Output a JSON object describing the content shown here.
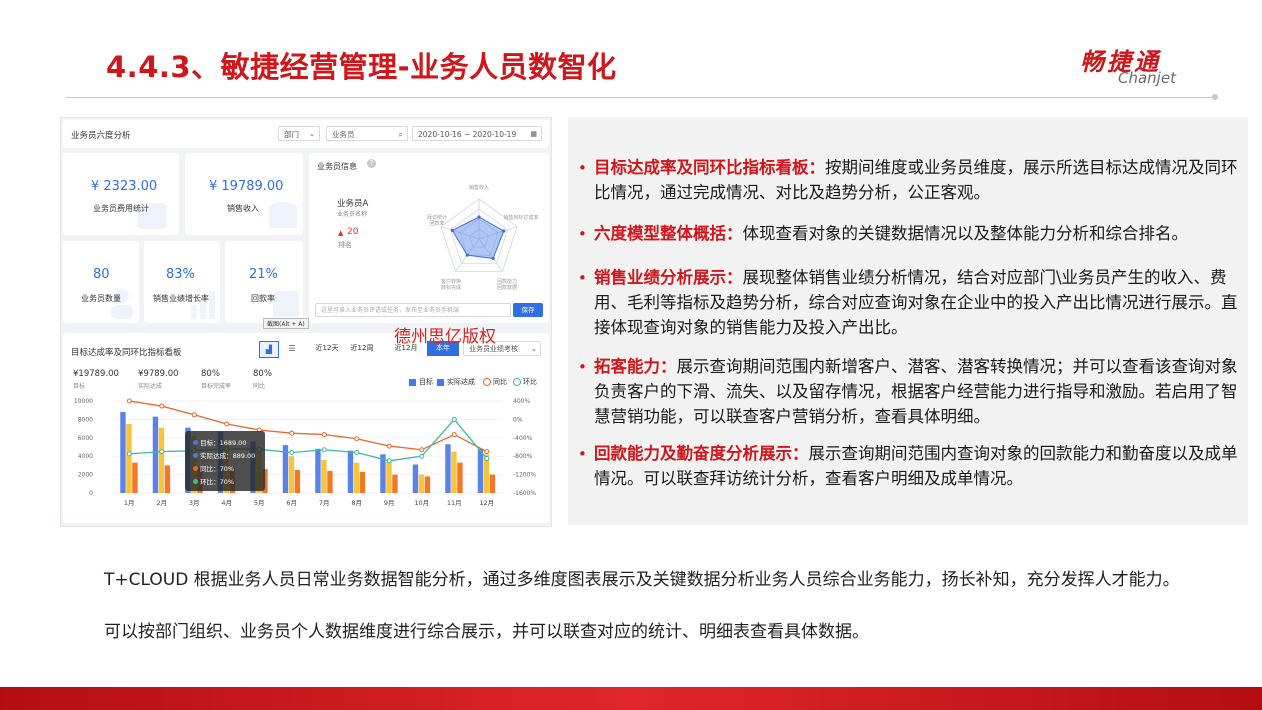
{
  "slide": {
    "title": "4.4.3、敏捷经营管理-业务人员数智化",
    "logo_cn": "畅捷通",
    "logo_en": "Chanjet"
  },
  "dashboard": {
    "header": {
      "title": "业务员六度分析",
      "dept_select": "部门",
      "salesperson_placeholder": "业务员",
      "date_range": "2020-10-16 ~ 2020-10-19"
    },
    "kpis": [
      {
        "value": "¥ 2323.00",
        "label": "业务员费用统计"
      },
      {
        "value": "¥ 19789.00",
        "label": "销售收入"
      },
      {
        "value": "80",
        "label": "业务员数量"
      },
      {
        "value": "83%",
        "label": "销售业绩增长率"
      },
      {
        "value": "21%",
        "label": "回款率"
      }
    ],
    "info": {
      "title": "业务员信息",
      "name": "业务员A",
      "name_sub": "业务员名称",
      "rank": "20",
      "rank_label": "排名",
      "radar_labels": [
        "销售收入",
        "销售目标达成率",
        "回款能力",
        "客户转换",
        "拜访统计",
        "回款数据",
        "目标完成",
        "回款率"
      ],
      "radar_values": [
        0.55,
        0.65,
        0.6,
        0.5,
        0.7
      ],
      "input_placeholder": "这里可录入业务员评语或任务，发布至业务员手机端",
      "save_button": "保存"
    },
    "tooltip_hint": "截图(Alt + A)",
    "watermark": "德州思亿版权",
    "chart_card": {
      "title": "目标达成率及同环比指标看板",
      "tabs": [
        "近12天",
        "近12周",
        "近12月",
        "本年"
      ],
      "active_tab": "本年",
      "metric_select": "业务员业绩考核",
      "summary": [
        {
          "value": "¥19789.00",
          "label": "目标"
        },
        {
          "value": "¥9789.00",
          "label": "实际达成"
        },
        {
          "value": "80%",
          "label": "目标完成率"
        },
        {
          "value": "80%",
          "label": "同比"
        }
      ],
      "tooltip": [
        {
          "label": "目标",
          "value": "1689.00",
          "color": "#3d7bf0"
        },
        {
          "label": "实际达成",
          "value": "889.00",
          "color": "#3d7bf0"
        },
        {
          "label": "同比",
          "value": "70%",
          "color": "#e8672f"
        },
        {
          "label": "环比",
          "value": "70%",
          "color": "#3fb9a0"
        }
      ]
    }
  },
  "chart_data": {
    "type": "bar",
    "categories": [
      "1月",
      "2月",
      "3月",
      "4月",
      "5月",
      "6月",
      "7月",
      "8月",
      "9月",
      "10月",
      "11月",
      "12月"
    ],
    "series": [
      {
        "name": "目标",
        "kind": "bar",
        "axis": "left",
        "color": "#5b82e8",
        "values": [
          8800,
          8300,
          7100,
          6700,
          5600,
          5200,
          4800,
          4600,
          4200,
          3100,
          5300,
          4800
        ]
      },
      {
        "name": "实际达成",
        "kind": "bar",
        "axis": "left",
        "color": "#f7c43c",
        "values": [
          7500,
          7100,
          6200,
          5300,
          4600,
          4000,
          3600,
          3300,
          3400,
          2000,
          4500,
          4200
        ]
      },
      {
        "name": "实际达成",
        "kind": "bar",
        "axis": "left",
        "color": "#f07828",
        "values": [
          3300,
          3000,
          2800,
          2700,
          2600,
          2500,
          2400,
          2300,
          2000,
          1800,
          3300,
          2000
        ]
      },
      {
        "name": "同比",
        "kind": "line",
        "axis": "right",
        "color": "#e8672f",
        "values": [
          400,
          290,
          100,
          -100,
          -230,
          -300,
          -330,
          -420,
          -580,
          -660,
          -330,
          -700
        ]
      },
      {
        "name": "环比",
        "kind": "line",
        "axis": "right",
        "color": "#3fb9a0",
        "values": [
          -750,
          -700,
          -680,
          -640,
          -650,
          -720,
          -660,
          -720,
          -900,
          -800,
          0,
          -850
        ]
      }
    ],
    "legend": [
      "目标",
      "实际达成",
      "同比",
      "环比"
    ],
    "ylim": [
      0,
      10000
    ],
    "yticks": [
      "10000",
      "8000",
      "6000",
      "4000",
      "2000",
      "0"
    ],
    "y2lim": [
      -1600,
      400
    ],
    "y2ticks": [
      "400%",
      "0%",
      "-400%",
      "-800%",
      "-1200%",
      "-1600%"
    ]
  },
  "bullets": [
    {
      "title": "目标达成率及同环比指标看板：",
      "text": "按期间维度或业务员维度，展示所选目标达成情况及同环比情况，通过完成情况、对比及趋势分析，公正客观。"
    },
    {
      "title": "六度模型整体概括：",
      "text": "体现查看对象的关键数据情况以及整体能力分析和综合排名。"
    },
    {
      "title": "销售业绩分析展示：",
      "text": "展现整体销售业绩分析情况，结合对应部门\\业务员产生的收入、费用、毛利等指标及趋势分析，综合对应查询对象在企业中的投入产出比情况进行展示。直接体现查询对象的销售能力及投入产出比。"
    },
    {
      "title": "拓客能力：",
      "text": "展示查询期间范围内新增客户、潜客、潜客转换情况；并可以查看该查询对象负责客户的下滑、流失、以及留存情况，根据客户经营能力进行指导和激励。若启用了智慧营销功能，可以联查客户营销分析，查看具体明细。"
    },
    {
      "title": "回款能力及勤奋度分析展示：",
      "text": "展示查询期间范围内查询对象的回款能力和勤奋度以及成单情况。可以联查拜访统计分析，查看客户明细及成单情况。"
    }
  ],
  "paragraphs": [
    "T+CLOUD 根据业务人员日常业务数据智能分析，通过多维度图表展示及关键数据分析业务人员综合业务能力，扬长补知，充分发挥人才能力。",
    "可以按部门组织、业务员个人数据维度进行综合展示，并可以联查对应的统计、明细表查看具体数据。"
  ]
}
